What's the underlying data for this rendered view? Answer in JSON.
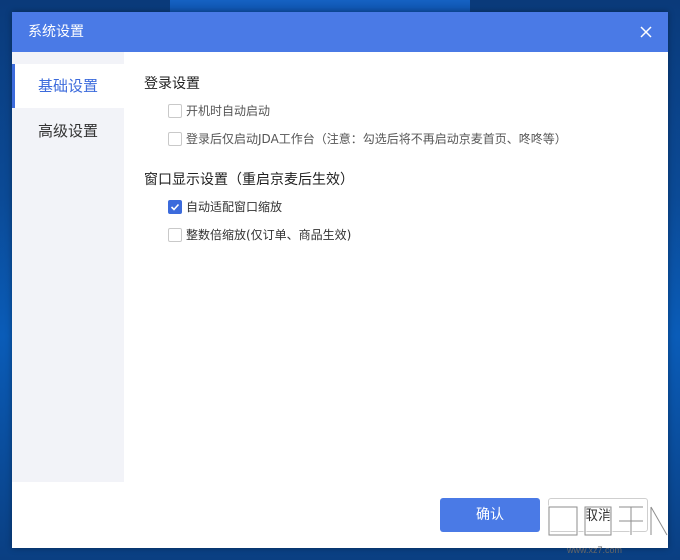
{
  "window": {
    "title": "系统设置",
    "close_icon": "close-icon"
  },
  "sidebar": {
    "items": [
      {
        "label": "基础设置",
        "active": true
      },
      {
        "label": "高级设置",
        "active": false
      }
    ]
  },
  "main": {
    "sections": [
      {
        "title": "登录设置",
        "options": [
          {
            "label": "开机时自动启动",
            "checked": false
          },
          {
            "label": "登录后仅启动JDA工作台（注意：勾选后将不再启动京麦首页、咚咚等）",
            "checked": false
          }
        ]
      },
      {
        "title": "窗口显示设置（重启京麦后生效）",
        "options": [
          {
            "label": "自动适配窗口缩放",
            "checked": true
          },
          {
            "label": "整数倍缩放(仅订单、商品生效)",
            "checked": false
          }
        ]
      }
    ]
  },
  "footer": {
    "ok_label": "确认",
    "cancel_label": "取消"
  },
  "watermark": {
    "text": "www.xz7.com"
  },
  "colors": {
    "accent": "#4a7ae6",
    "active_nav": "#3c6bdc",
    "sidebar_bg": "#f2f3f8"
  }
}
